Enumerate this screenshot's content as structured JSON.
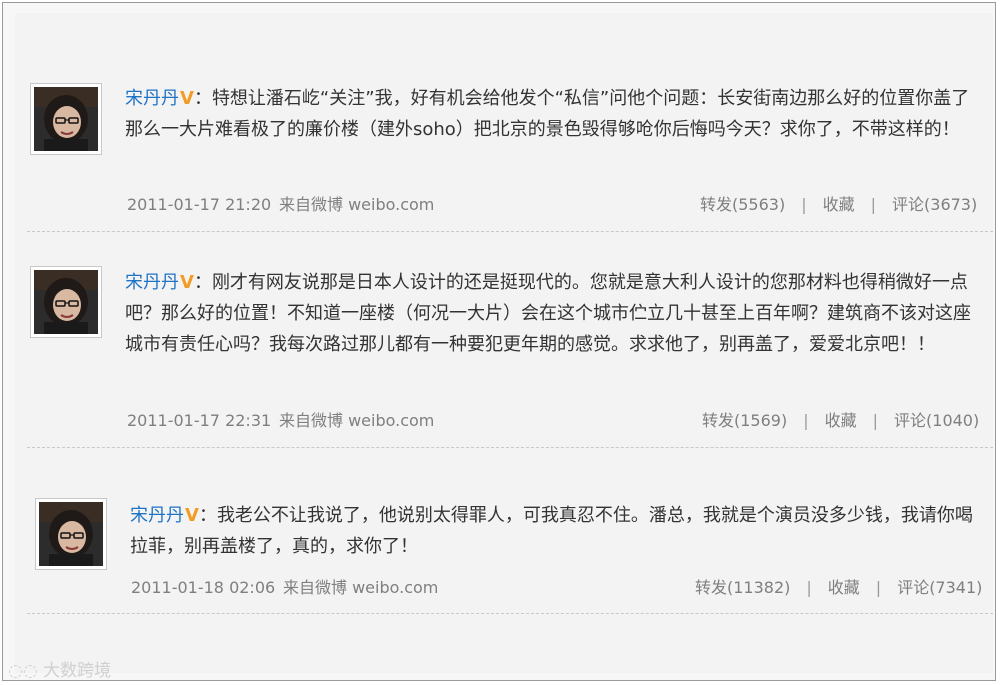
{
  "posts": [
    {
      "author": "宋丹丹",
      "badge": "V",
      "separator": "：",
      "text": "特想让潘石屹“关注”我，好有机会给他发个“私信”问他个问题：长安街南边那么好的位置你盖了那么一大片难看极了的廉价楼（建外soho）把北京的景色毁得够呛你后悔吗今天？求你了，不带这样的！",
      "time": "2011-01-17 21:20",
      "source": "来自微博 weibo.com",
      "forward": "转发(5563)",
      "favorite": "收藏",
      "comment": "评论(3673)"
    },
    {
      "author": "宋丹丹",
      "badge": "V",
      "separator": "：",
      "text": "刚才有网友说那是日本人设计的还是挺现代的。您就是意大利人设计的您那材料也得稍微好一点吧？那么好的位置！不知道一座楼（何况一大片）会在这个城市伫立几十甚至上百年啊？建筑商不该对这座城市有责任心吗？我每次路过那儿都有一种要犯更年期的感觉。求求他了，别再盖了，爱爱北京吧！！",
      "time": "2011-01-17 22:31",
      "source": "来自微博 weibo.com",
      "forward": "转发(1569)",
      "favorite": "收藏",
      "comment": "评论(1040)"
    },
    {
      "author": "宋丹丹",
      "badge": "V",
      "separator": "：",
      "text": "我老公不让我说了，他说别太得罪人，可我真忍不住。潘总，我就是个演员没多少钱，我请你喝拉菲，别再盖楼了，真的，求你了！",
      "time": "2011-01-18 02:06",
      "source": "来自微博 weibo.com",
      "forward": "转发(11382)",
      "favorite": "收藏",
      "comment": "评论(7341)"
    }
  ],
  "watermark": "大数跨境",
  "icons": {
    "avatar": "avatar-photo",
    "verified": "verified-badge"
  },
  "colors": {
    "author": "#1e73c5",
    "verified": "#f29b25",
    "meta": "#7f7f7f",
    "text": "#333333"
  }
}
